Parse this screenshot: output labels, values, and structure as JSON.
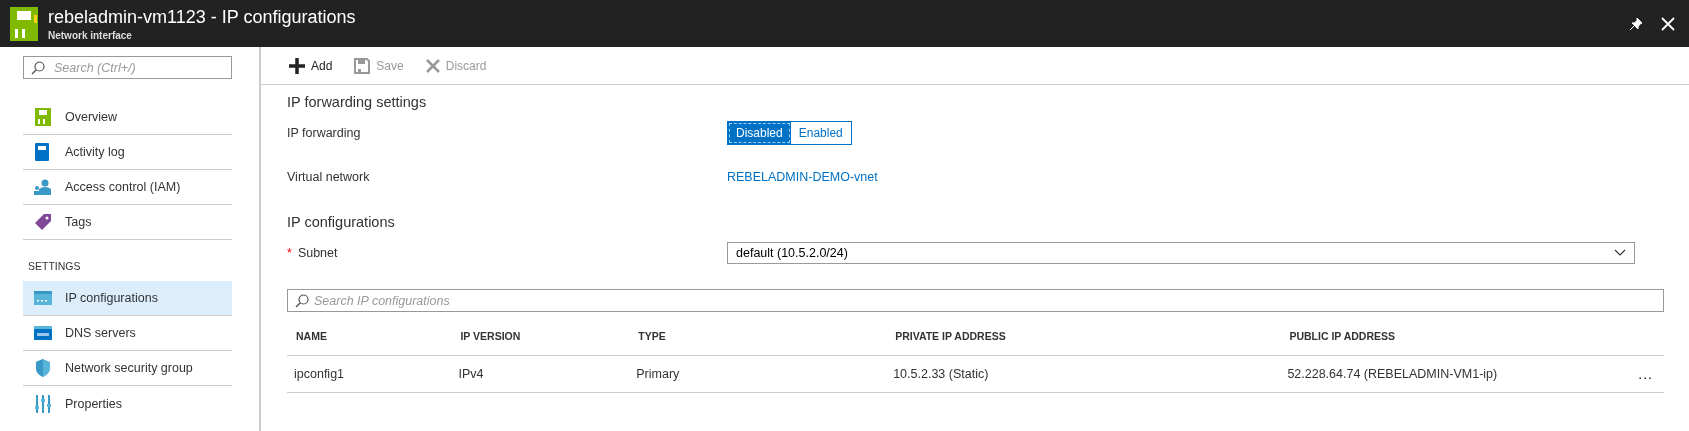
{
  "header": {
    "title": "rebeladmin-vm1123 - IP configurations",
    "subtitle": "Network interface"
  },
  "sidebar": {
    "search": {
      "placeholder": "Search (Ctrl+/)"
    },
    "groups": [
      {
        "items": [
          {
            "label": "Overview",
            "selected": false
          },
          {
            "label": "Activity log",
            "selected": false
          },
          {
            "label": "Access control (IAM)",
            "selected": false
          },
          {
            "label": "Tags",
            "selected": false
          }
        ]
      },
      {
        "heading": "SETTINGS",
        "items": [
          {
            "label": "IP configurations",
            "selected": true
          },
          {
            "label": "DNS servers",
            "selected": false
          },
          {
            "label": "Network security group",
            "selected": false
          },
          {
            "label": "Properties",
            "selected": false
          }
        ]
      }
    ]
  },
  "toolbar": [
    {
      "label": "Add",
      "disabled": false
    },
    {
      "label": "Save",
      "disabled": true
    },
    {
      "label": "Discard",
      "disabled": true
    }
  ],
  "forwarding": {
    "heading": "IP forwarding settings",
    "label": "IP forwarding",
    "options": [
      {
        "label": "Disabled",
        "selected": true
      },
      {
        "label": "Enabled",
        "selected": false
      }
    ],
    "network_label": "Virtual network",
    "network_link": "REBELADMIN-DEMO-vnet"
  },
  "configs": {
    "heading": "IP configurations",
    "subnet_label": "Subnet",
    "required_mark": "*",
    "subnet_value": "default (10.5.2.0/24)",
    "search": {
      "placeholder": "Search IP configurations"
    },
    "table": {
      "columns": [
        "NAME",
        "IP VERSION",
        "TYPE",
        "PRIVATE IP ADDRESS",
        "PUBLIC IP ADDRESS"
      ],
      "rows": [
        {
          "cells": [
            "ipconfig1",
            "IPv4",
            "Primary",
            "10.5.2.33 (Static)",
            "52.228.64.74 (REBELADMIN-VM1-ip)"
          ],
          "menu": "..."
        }
      ]
    }
  }
}
